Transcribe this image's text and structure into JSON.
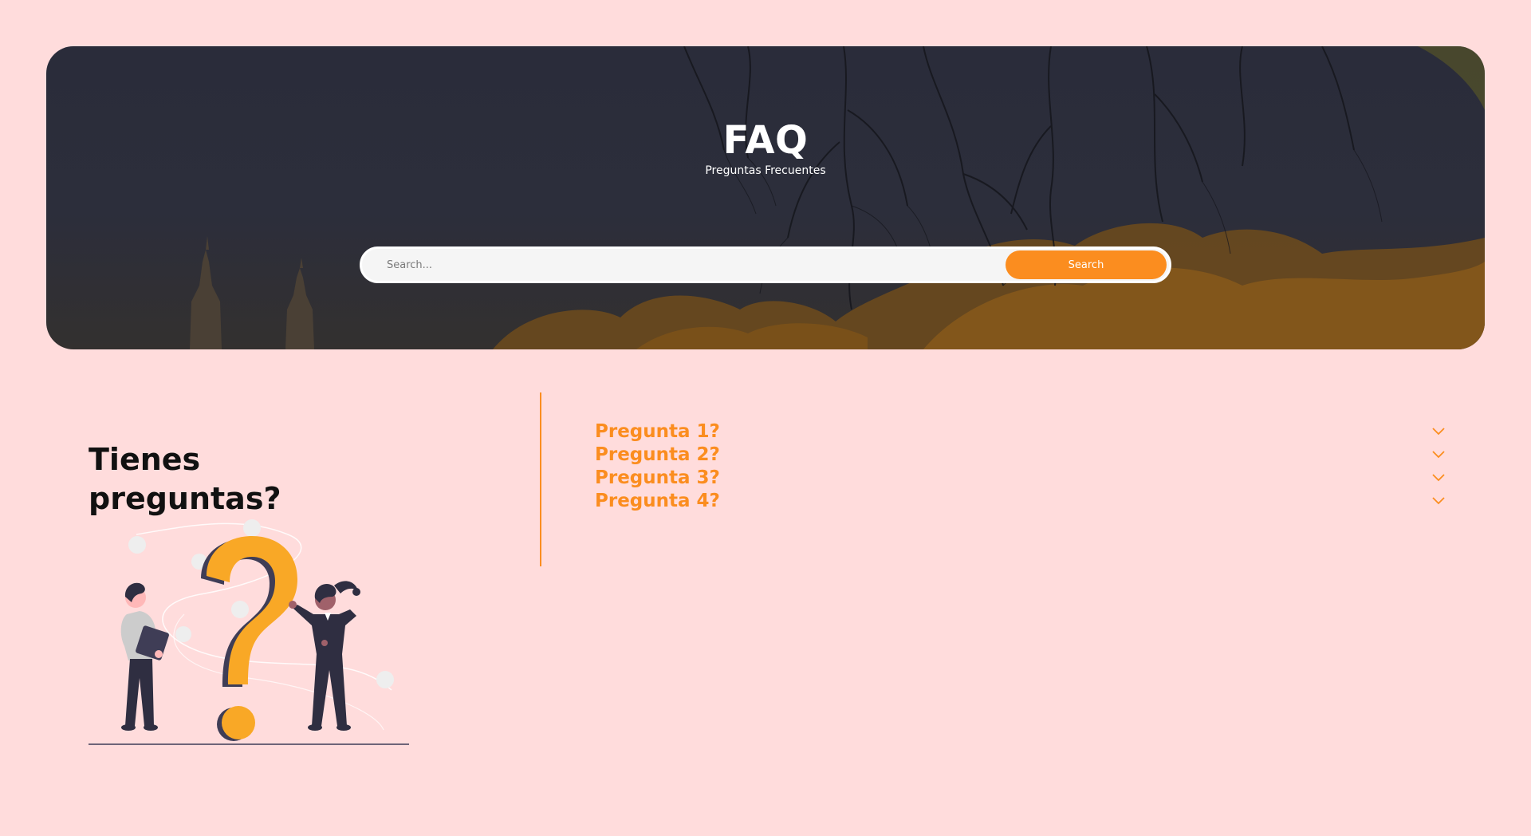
{
  "hero": {
    "title": "FAQ",
    "subtitle": "Preguntas Frecuentes"
  },
  "search": {
    "placeholder": "Search...",
    "value": "",
    "button_label": "Search"
  },
  "side": {
    "title": "Tienes preguntas?"
  },
  "faq": {
    "items": [
      {
        "question": "Pregunta 1?",
        "icon": "chevron-down-icon"
      },
      {
        "question": "Pregunta 2?",
        "icon": "chevron-down-icon"
      },
      {
        "question": "Pregunta 3?",
        "icon": "chevron-down-icon"
      },
      {
        "question": "Pregunta 4?",
        "icon": "chevron-down-icon"
      }
    ]
  },
  "colors": {
    "background": "#ffdcdc",
    "accent": "#fb8d1f",
    "hero_dark": "#2a2c3a",
    "text_dark": "#111111"
  }
}
